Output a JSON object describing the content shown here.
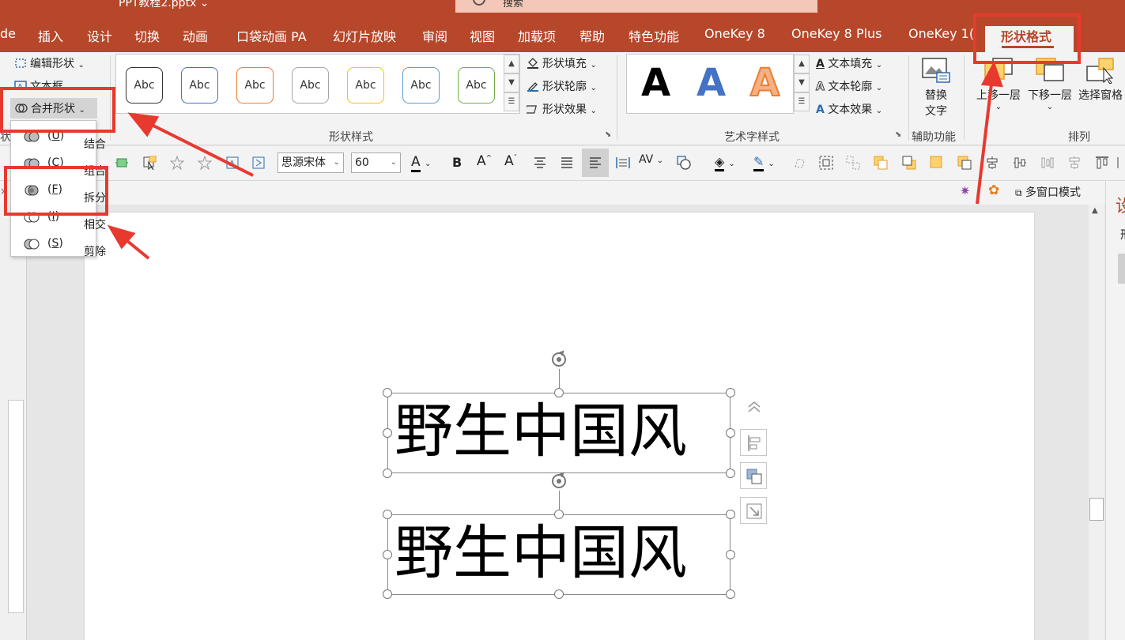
{
  "app": {
    "doc_title": "PPT教程2.pptx ⌄",
    "search_placeholder": "搜索"
  },
  "menu": {
    "tabs": [
      "de",
      "插入",
      "设计",
      "切换",
      "动画",
      "口袋动画 PA",
      "幻灯片放映",
      "审阅",
      "视图",
      "加载项",
      "帮助",
      "特色功能",
      "OneKey 8",
      "OneKey 8 Plus",
      "OneKey 1("
    ],
    "active_tab": "形状格式"
  },
  "ribbon": {
    "insert_shapes": {
      "edit_shape": "编辑形状",
      "text_box": "文本框",
      "merge_shapes": "合并形状",
      "cut_label": "状"
    },
    "shape_styles": {
      "label": "形状样式",
      "sample_text": "Abc",
      "swatch_colors": [
        "#333333",
        "#4472c4",
        "#ed7d31",
        "#a5a5a5",
        "#ffc000",
        "#5b9bd5",
        "#70ad47"
      ],
      "fill": "形状填充",
      "outline": "形状轮廓",
      "effects": "形状效果"
    },
    "wordart_styles": {
      "label": "艺术字样式",
      "sample": "A",
      "text_fill": "文本填充",
      "text_outline": "文本轮廓",
      "text_effects": "文本效果"
    },
    "accessibility": {
      "label": "辅助功能",
      "alt_text_line1": "替换",
      "alt_text_line2": "文字"
    },
    "arrange": {
      "label": "排列",
      "bring_forward": "上移一层",
      "send_backward": "下移一层",
      "selection_pane": "选择窗格"
    }
  },
  "format_toolbar": {
    "font_name": "思源宋体",
    "font_size": "60"
  },
  "bar2": {
    "multi_window": "多窗口模式"
  },
  "merge_menu": {
    "items": [
      {
        "label": "结合",
        "key": "U"
      },
      {
        "label": "组合",
        "key": "C"
      },
      {
        "label": "拆分",
        "key": "F"
      },
      {
        "label": "相交",
        "key": "I"
      },
      {
        "label": "剪除",
        "key": "S"
      }
    ]
  },
  "slide": {
    "text1": "野生中国风",
    "text2": "野生中国风"
  },
  "right_pane": {
    "title_char": "设",
    "sub_char": "形"
  },
  "colors": {
    "brand": "#b7472a",
    "annotation": "#e8392f"
  }
}
